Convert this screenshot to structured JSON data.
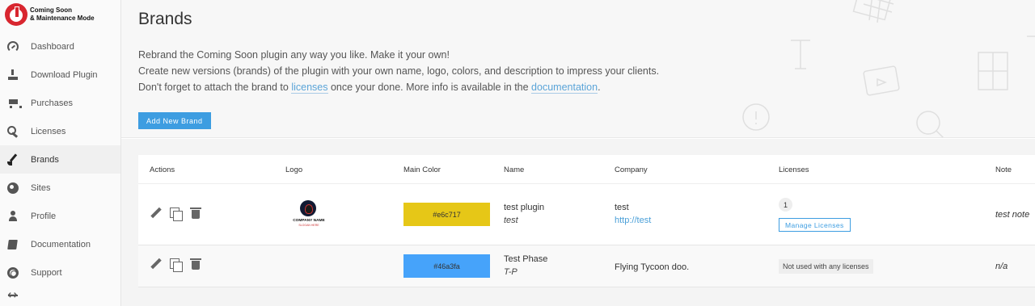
{
  "app": {
    "logo_line1": "Coming Soon",
    "logo_line2": "& Maintenance Mode"
  },
  "sidebar": {
    "items": [
      {
        "label": "Dashboard",
        "icon": "dashboard-icon"
      },
      {
        "label": "Download Plugin",
        "icon": "download-icon"
      },
      {
        "label": "Purchases",
        "icon": "cart-icon"
      },
      {
        "label": "Licenses",
        "icon": "key-icon"
      },
      {
        "label": "Brands",
        "icon": "brush-icon",
        "active": true
      },
      {
        "label": "Sites",
        "icon": "globe-icon"
      },
      {
        "label": "Profile",
        "icon": "user-icon"
      },
      {
        "label": "Documentation",
        "icon": "book-icon"
      },
      {
        "label": "Support",
        "icon": "lifebuoy-icon"
      }
    ],
    "collapse_icon": "arrows-horizontal-icon"
  },
  "header": {
    "title": "Brands",
    "line1": "Rebrand the Coming Soon plugin any way you like. Make it your own!",
    "line2": "Create new versions (brands) of the plugin with your own name, logo, colors, and description to impress your clients.",
    "line3_a": "Don't forget to attach the brand to ",
    "line3_link1": "licenses",
    "line3_b": " once your done. More info is available in the ",
    "line3_link2": "documentation",
    "line3_c": ".",
    "add_button": "Add New Brand"
  },
  "table": {
    "columns": {
      "actions": "Actions",
      "logo": "Logo",
      "main_color": "Main Color",
      "name": "Name",
      "company": "Company",
      "licenses": "Licenses",
      "note": "Note"
    },
    "rows": [
      {
        "logo_line1": "COMPANY NAME",
        "logo_line2": "SLOGAN HERE",
        "color": "#e6c717",
        "name": "test plugin",
        "short_name": "test",
        "company": "test",
        "company_url": "http://test",
        "license_count": "1",
        "manage_label": "Manage Licenses",
        "note": "test note"
      },
      {
        "color": "#46a3fa",
        "name": "Test Phase",
        "short_name": "T-P",
        "company": "Flying Tycoon doo.",
        "licenses_text": "Not used with any licenses",
        "note": "n/a"
      }
    ]
  },
  "colors": {
    "accent": "#3d9de1",
    "brand_red": "#d8262f"
  }
}
